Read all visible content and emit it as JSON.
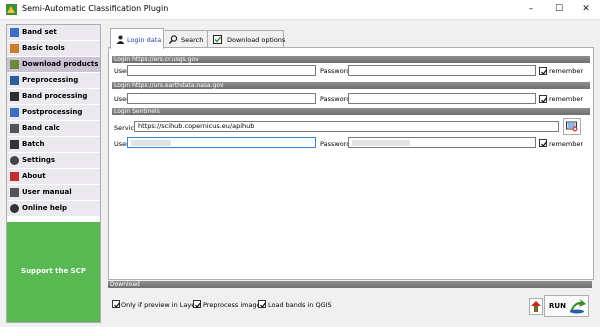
{
  "window": {
    "title": "Semi-Automatic Classification Plugin",
    "buttons": [
      "–",
      "☐",
      "✕"
    ]
  },
  "sidebar": {
    "items": [
      {
        "label": "Band set",
        "icon": "band-set-icon",
        "color": "#3a6fc4"
      },
      {
        "label": "Basic tools",
        "icon": "basic-tools-icon",
        "color": "#c97d2a"
      },
      {
        "label": "Download products",
        "icon": "download-icon",
        "color": "#6a8a3a"
      },
      {
        "label": "Preprocessing",
        "icon": "preprocessing-icon",
        "color": "#2a5f9e"
      },
      {
        "label": "Band processing",
        "icon": "band-processing-icon",
        "color": "#2e2e2e"
      },
      {
        "label": "Postprocessing",
        "icon": "postprocessing-icon",
        "color": "#3a6fc4"
      },
      {
        "label": "Band calc",
        "icon": "band-calc-icon",
        "color": "#555555"
      },
      {
        "label": "Batch",
        "icon": "batch-icon",
        "color": "#333333"
      },
      {
        "label": "Settings",
        "icon": "settings-icon",
        "color": "#444444"
      },
      {
        "label": "About",
        "icon": "about-icon",
        "color": "#c03030"
      },
      {
        "label": "User manual",
        "icon": "user-manual-icon",
        "color": "#555555"
      },
      {
        "label": "Online help",
        "icon": "online-help-icon",
        "color": "#333333"
      }
    ],
    "selected_index": 2,
    "support_label": "Support the SCP"
  },
  "tabs": [
    {
      "label": "Login data",
      "icon": "user-icon",
      "active": true
    },
    {
      "label": "Search",
      "icon": "search-icon",
      "active": false
    },
    {
      "label": "Download options",
      "icon": "checkbox-icon",
      "active": false
    }
  ],
  "login": {
    "usgs": {
      "header": "Login https://ers.cr.usgs.gov",
      "user_label": "User",
      "user_value": "",
      "password_label": "Password",
      "password_value": "",
      "remember_label": "remember",
      "remember_checked": true
    },
    "earthdata": {
      "header": "Login https://urs.earthdata.nasa.gov",
      "user_label": "User",
      "user_value": "",
      "password_label": "Password",
      "password_value": "",
      "remember_label": "remember",
      "remember_checked": true
    },
    "sentinels": {
      "header": "Login Sentinels",
      "service_label": "Service",
      "service_value": "https://scihub.copernicus.eu/apihub",
      "user_label": "User",
      "password_label": "Password",
      "remember_label": "remember",
      "remember_checked": true
    }
  },
  "download": {
    "header": "Download",
    "only_preview_label": "Only if preview in Layers",
    "only_preview_checked": true,
    "preprocess_label": "Preprocess images",
    "preprocess_checked": true,
    "load_bands_label": "Load bands in QGIS",
    "load_bands_checked": true,
    "run_label": "RUN"
  }
}
